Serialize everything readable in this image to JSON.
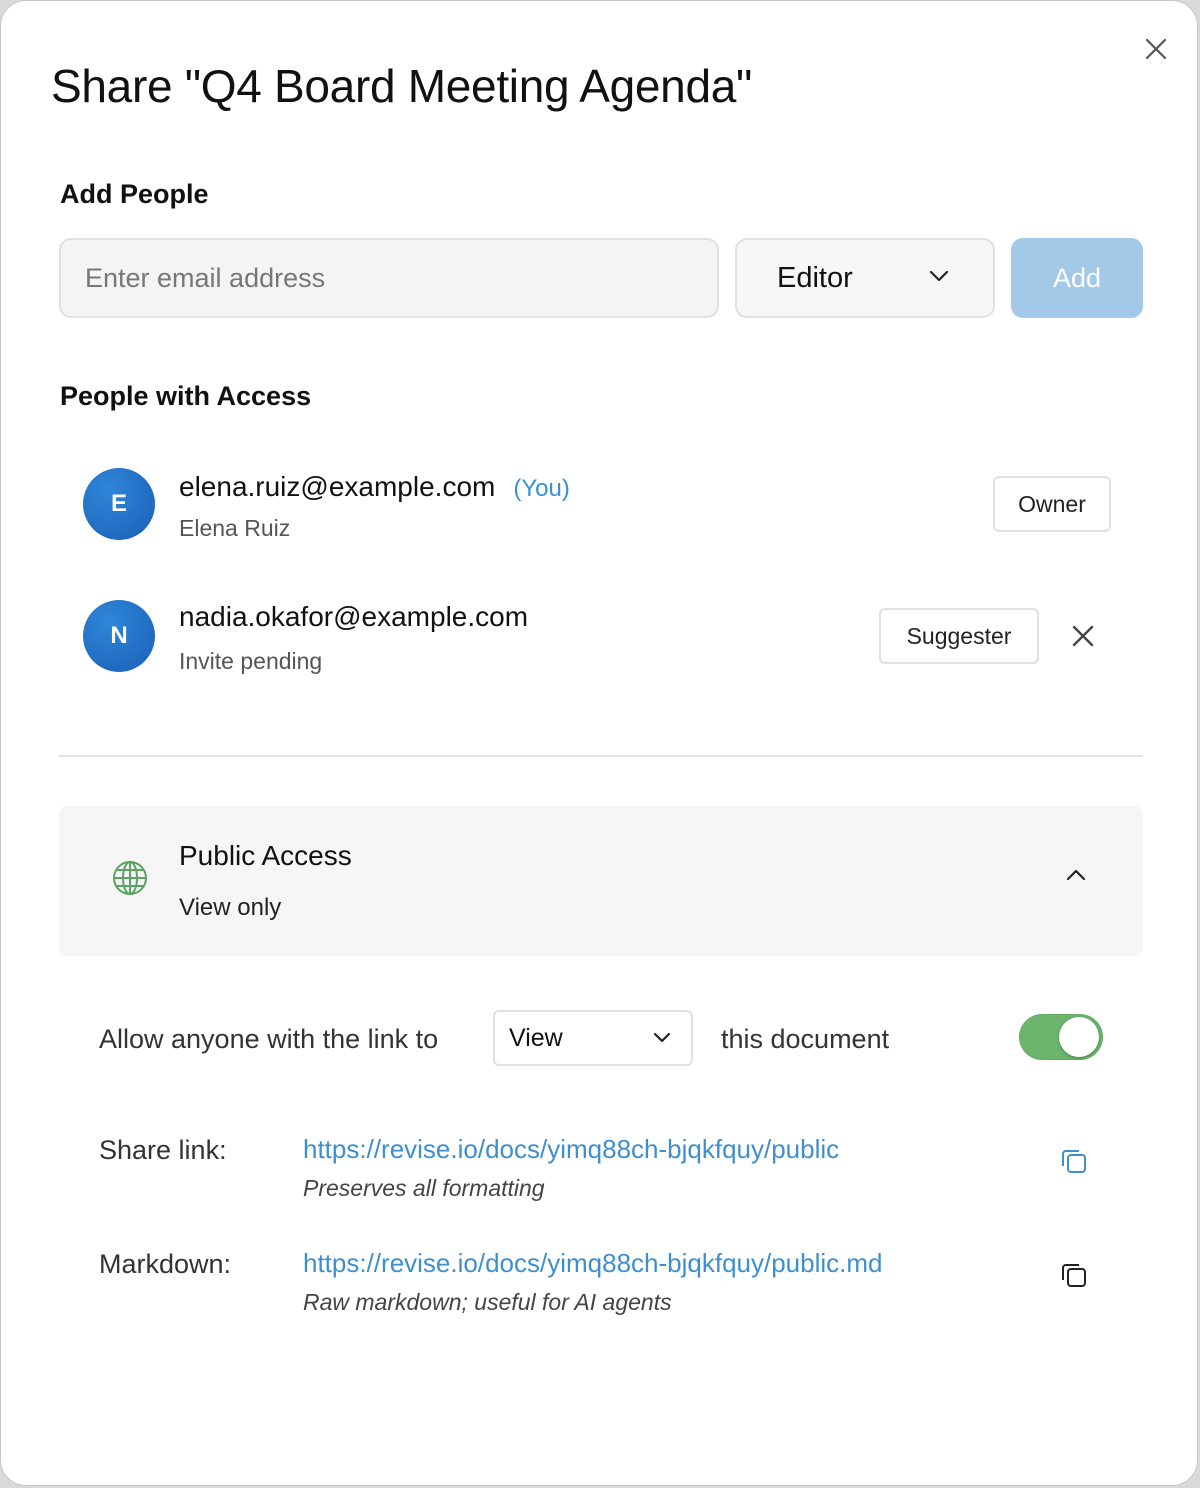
{
  "dialog": {
    "title": "Share \"Q4 Board Meeting Agenda\""
  },
  "add_people": {
    "heading": "Add People",
    "email_placeholder": "Enter email address",
    "email_value": "",
    "role_selected": "Editor",
    "add_label": "Add"
  },
  "access": {
    "heading": "People with Access",
    "people": [
      {
        "initial": "E",
        "email": "elena.ruiz@example.com",
        "you_tag": "(You)",
        "subtitle": "Elena Ruiz",
        "role": "Owner"
      },
      {
        "initial": "N",
        "email": "nadia.okafor@example.com",
        "subtitle": "Invite pending",
        "role": "Suggester"
      }
    ]
  },
  "public_access": {
    "title": "Public Access",
    "subtitle": "View only",
    "sentence_prefix": "Allow anyone with the link to",
    "permission_selected": "View",
    "sentence_suffix": "this document",
    "toggle_on": true,
    "toggle_color": "#6bb56d"
  },
  "links": [
    {
      "label": "Share link:",
      "url": "https://revise.io/docs/yimq88ch-bjqkfquy/public",
      "description": "Preserves all formatting"
    },
    {
      "label": "Markdown:",
      "url": "https://revise.io/docs/yimq88ch-bjqkfquy/public.md",
      "description": "Raw markdown; useful for AI agents"
    }
  ],
  "colors": {
    "accent_link": "#3d8fd0",
    "add_button": "#a3c8e8",
    "avatar": "#1a5fb6",
    "globe": "#5aa363"
  }
}
